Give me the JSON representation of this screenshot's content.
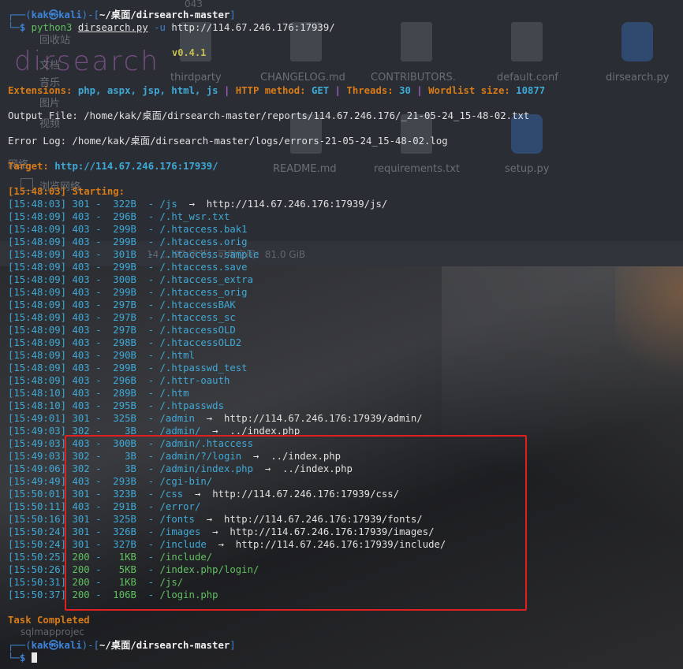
{
  "background": {
    "faded_items": [
      "043",
      "回收站",
      "文档",
      "音乐",
      "图片",
      "视频",
      "网络",
      "浏览网络",
      "thirdparty",
      "CHANGELOG.md",
      "CONTRIBUTORS.",
      "default.conf",
      "dirsearch.py",
      "README.md",
      "requirements.txt",
      "setup.py",
      "14 ... 97 字节), 可用空间：81.0 GiB",
      "sqlmapprojec"
    ]
  },
  "prompt_top": {
    "user": "kak",
    "host": "kali",
    "path": "~/桌面/dirsearch-master",
    "command": "python3",
    "script": "dirsearch.py",
    "flag": "-u",
    "url": "http://114.67.246.176:17939/"
  },
  "banner": {
    "logo": "dirsearch",
    "version": "v0.4.1"
  },
  "config": {
    "extensions_label": "Extensions:",
    "extensions": "php, aspx, jsp, html, js",
    "method_label": "HTTP method:",
    "method": "GET",
    "threads_label": "Threads:",
    "threads": "30",
    "wordlist_label": "Wordlist size:",
    "wordlist_size": "10877",
    "separator": "|"
  },
  "output_file": "Output File: /home/kak/桌面/dirsearch-master/reports/114.67.246.176/_21-05-24_15-48-02.txt",
  "error_log": "Error Log: /home/kak/桌面/dirsearch-master/logs/errors-21-05-24_15-48-02.log",
  "target": {
    "label": "Target:",
    "url": "http://114.67.246.176:17939/"
  },
  "starting": {
    "time": "[15:48:03]",
    "text": "Starting:"
  },
  "results": [
    {
      "time": "[15:48:03]",
      "status": "301",
      "size": "322B",
      "path": "/js",
      "redirect": "http://114.67.246.176:17939/js/"
    },
    {
      "time": "[15:48:09]",
      "status": "403",
      "size": "296B",
      "path": "/.ht_wsr.txt",
      "redirect": ""
    },
    {
      "time": "[15:48:09]",
      "status": "403",
      "size": "299B",
      "path": "/.htaccess.bak1",
      "redirect": ""
    },
    {
      "time": "[15:48:09]",
      "status": "403",
      "size": "299B",
      "path": "/.htaccess.orig",
      "redirect": ""
    },
    {
      "time": "[15:48:09]",
      "status": "403",
      "size": "301B",
      "path": "/.htaccess.sample",
      "redirect": ""
    },
    {
      "time": "[15:48:09]",
      "status": "403",
      "size": "299B",
      "path": "/.htaccess.save",
      "redirect": ""
    },
    {
      "time": "[15:48:09]",
      "status": "403",
      "size": "300B",
      "path": "/.htaccess_extra",
      "redirect": ""
    },
    {
      "time": "[15:48:09]",
      "status": "403",
      "size": "299B",
      "path": "/.htaccess_orig",
      "redirect": ""
    },
    {
      "time": "[15:48:09]",
      "status": "403",
      "size": "297B",
      "path": "/.htaccessBAK",
      "redirect": ""
    },
    {
      "time": "[15:48:09]",
      "status": "403",
      "size": "297B",
      "path": "/.htaccess_sc",
      "redirect": ""
    },
    {
      "time": "[15:48:09]",
      "status": "403",
      "size": "297B",
      "path": "/.htaccessOLD",
      "redirect": ""
    },
    {
      "time": "[15:48:09]",
      "status": "403",
      "size": "298B",
      "path": "/.htaccessOLD2",
      "redirect": ""
    },
    {
      "time": "[15:48:09]",
      "status": "403",
      "size": "290B",
      "path": "/.html",
      "redirect": ""
    },
    {
      "time": "[15:48:09]",
      "status": "403",
      "size": "299B",
      "path": "/.htpasswd_test",
      "redirect": ""
    },
    {
      "time": "[15:48:09]",
      "status": "403",
      "size": "296B",
      "path": "/.httr-oauth",
      "redirect": ""
    },
    {
      "time": "[15:48:10]",
      "status": "403",
      "size": "289B",
      "path": "/.htm",
      "redirect": ""
    },
    {
      "time": "[15:48:10]",
      "status": "403",
      "size": "295B",
      "path": "/.htpasswds",
      "redirect": ""
    },
    {
      "time": "[15:49:01]",
      "status": "301",
      "size": "325B",
      "path": "/admin",
      "redirect": "http://114.67.246.176:17939/admin/"
    },
    {
      "time": "[15:49:03]",
      "status": "302",
      "size": "3B",
      "path": "/admin/",
      "redirect": "../index.php"
    },
    {
      "time": "[15:49:03]",
      "status": "403",
      "size": "300B",
      "path": "/admin/.htaccess",
      "redirect": ""
    },
    {
      "time": "[15:49:03]",
      "status": "302",
      "size": "3B",
      "path": "/admin/?/login",
      "redirect": "../index.php"
    },
    {
      "time": "[15:49:06]",
      "status": "302",
      "size": "3B",
      "path": "/admin/index.php",
      "redirect": "../index.php"
    },
    {
      "time": "[15:49:49]",
      "status": "403",
      "size": "293B",
      "path": "/cgi-bin/",
      "redirect": ""
    },
    {
      "time": "[15:50:01]",
      "status": "301",
      "size": "323B",
      "path": "/css",
      "redirect": "http://114.67.246.176:17939/css/"
    },
    {
      "time": "[15:50:11]",
      "status": "403",
      "size": "291B",
      "path": "/error/",
      "redirect": ""
    },
    {
      "time": "[15:50:16]",
      "status": "301",
      "size": "325B",
      "path": "/fonts",
      "redirect": "http://114.67.246.176:17939/fonts/"
    },
    {
      "time": "[15:50:24]",
      "status": "301",
      "size": "326B",
      "path": "/images",
      "redirect": "http://114.67.246.176:17939/images/"
    },
    {
      "time": "[15:50:24]",
      "status": "301",
      "size": "327B",
      "path": "/include",
      "redirect": "http://114.67.246.176:17939/include/"
    },
    {
      "time": "[15:50:25]",
      "status": "200",
      "size": "1KB",
      "path": "/include/",
      "redirect": ""
    },
    {
      "time": "[15:50:26]",
      "status": "200",
      "size": "5KB",
      "path": "/index.php/login/",
      "redirect": ""
    },
    {
      "time": "[15:50:31]",
      "status": "200",
      "size": "1KB",
      "path": "/js/",
      "redirect": ""
    },
    {
      "time": "[15:50:37]",
      "status": "200",
      "size": "106B",
      "path": "/login.php",
      "redirect": ""
    }
  ],
  "arrow": "→",
  "dash": "-",
  "task_completed": "Task Completed",
  "prompt_bottom": {
    "user": "kak",
    "host": "kali",
    "path": "~/桌面/dirsearch-master",
    "symbol": "$"
  },
  "colors": {
    "prompt": "#3d84d8",
    "orange": "#d77b18",
    "cyan": "#3fa9d6",
    "green": "#60c060",
    "separator": "#a35ec4",
    "highlight_box": "#e02020"
  }
}
